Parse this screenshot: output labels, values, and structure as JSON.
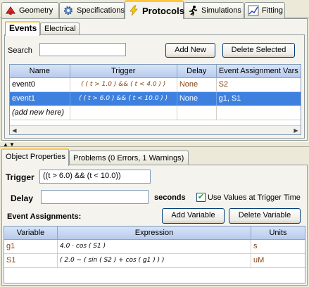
{
  "top_tabs": [
    {
      "label": "Geometry",
      "icon": "geometry-icon"
    },
    {
      "label": "Specifications",
      "icon": "gear-icon"
    },
    {
      "label": "Protocols",
      "icon": "lightning-icon"
    },
    {
      "label": "Simulations",
      "icon": "runner-icon"
    },
    {
      "label": "Fitting",
      "icon": "chart-icon"
    }
  ],
  "protocol_tabs": [
    "Events",
    "Electrical"
  ],
  "search": {
    "label": "Search",
    "value": ""
  },
  "buttons": {
    "add_new": "Add New",
    "delete_selected": "Delete Selected"
  },
  "events_table": {
    "columns": [
      "Name",
      "Trigger",
      "Delay",
      "Event Assignment Vars"
    ],
    "rows": [
      {
        "name": "event0",
        "trigger": "( ( t > 1.0 )  &&  ( t < 4.0 ) )",
        "delay": "None",
        "vars": "S2",
        "selected": false
      },
      {
        "name": "event1",
        "trigger": "( ( t > 6.0 )  &&  ( t < 10.0 ) )",
        "delay": "None",
        "vars": "g1, S1",
        "selected": true
      }
    ],
    "add_row": "(add new here)"
  },
  "bottom_tabs": [
    "Object Properties",
    "Problems (0 Errors, 1 Warnings)"
  ],
  "props": {
    "trigger_label": "Trigger",
    "trigger_value": "((t > 6.0) && (t < 10.0))",
    "delay_label": "Delay",
    "delay_value": "",
    "delay_unit": "seconds",
    "use_values_label": "Use Values at Trigger Time",
    "use_values_checked": true,
    "assignments_label": "Event Assignments:",
    "add_variable": "Add Variable",
    "delete_variable": "Delete Variable"
  },
  "assign_table": {
    "columns": [
      "Variable",
      "Expression",
      "Units"
    ],
    "rows": [
      {
        "variable": "g1",
        "expression": "4.0 · cos ( S1 )",
        "units": "s"
      },
      {
        "variable": "S1",
        "expression": "( 2.0 − ( sin ( S2 ) + cos ( g1 ) ) )",
        "units": "uM"
      }
    ]
  }
}
